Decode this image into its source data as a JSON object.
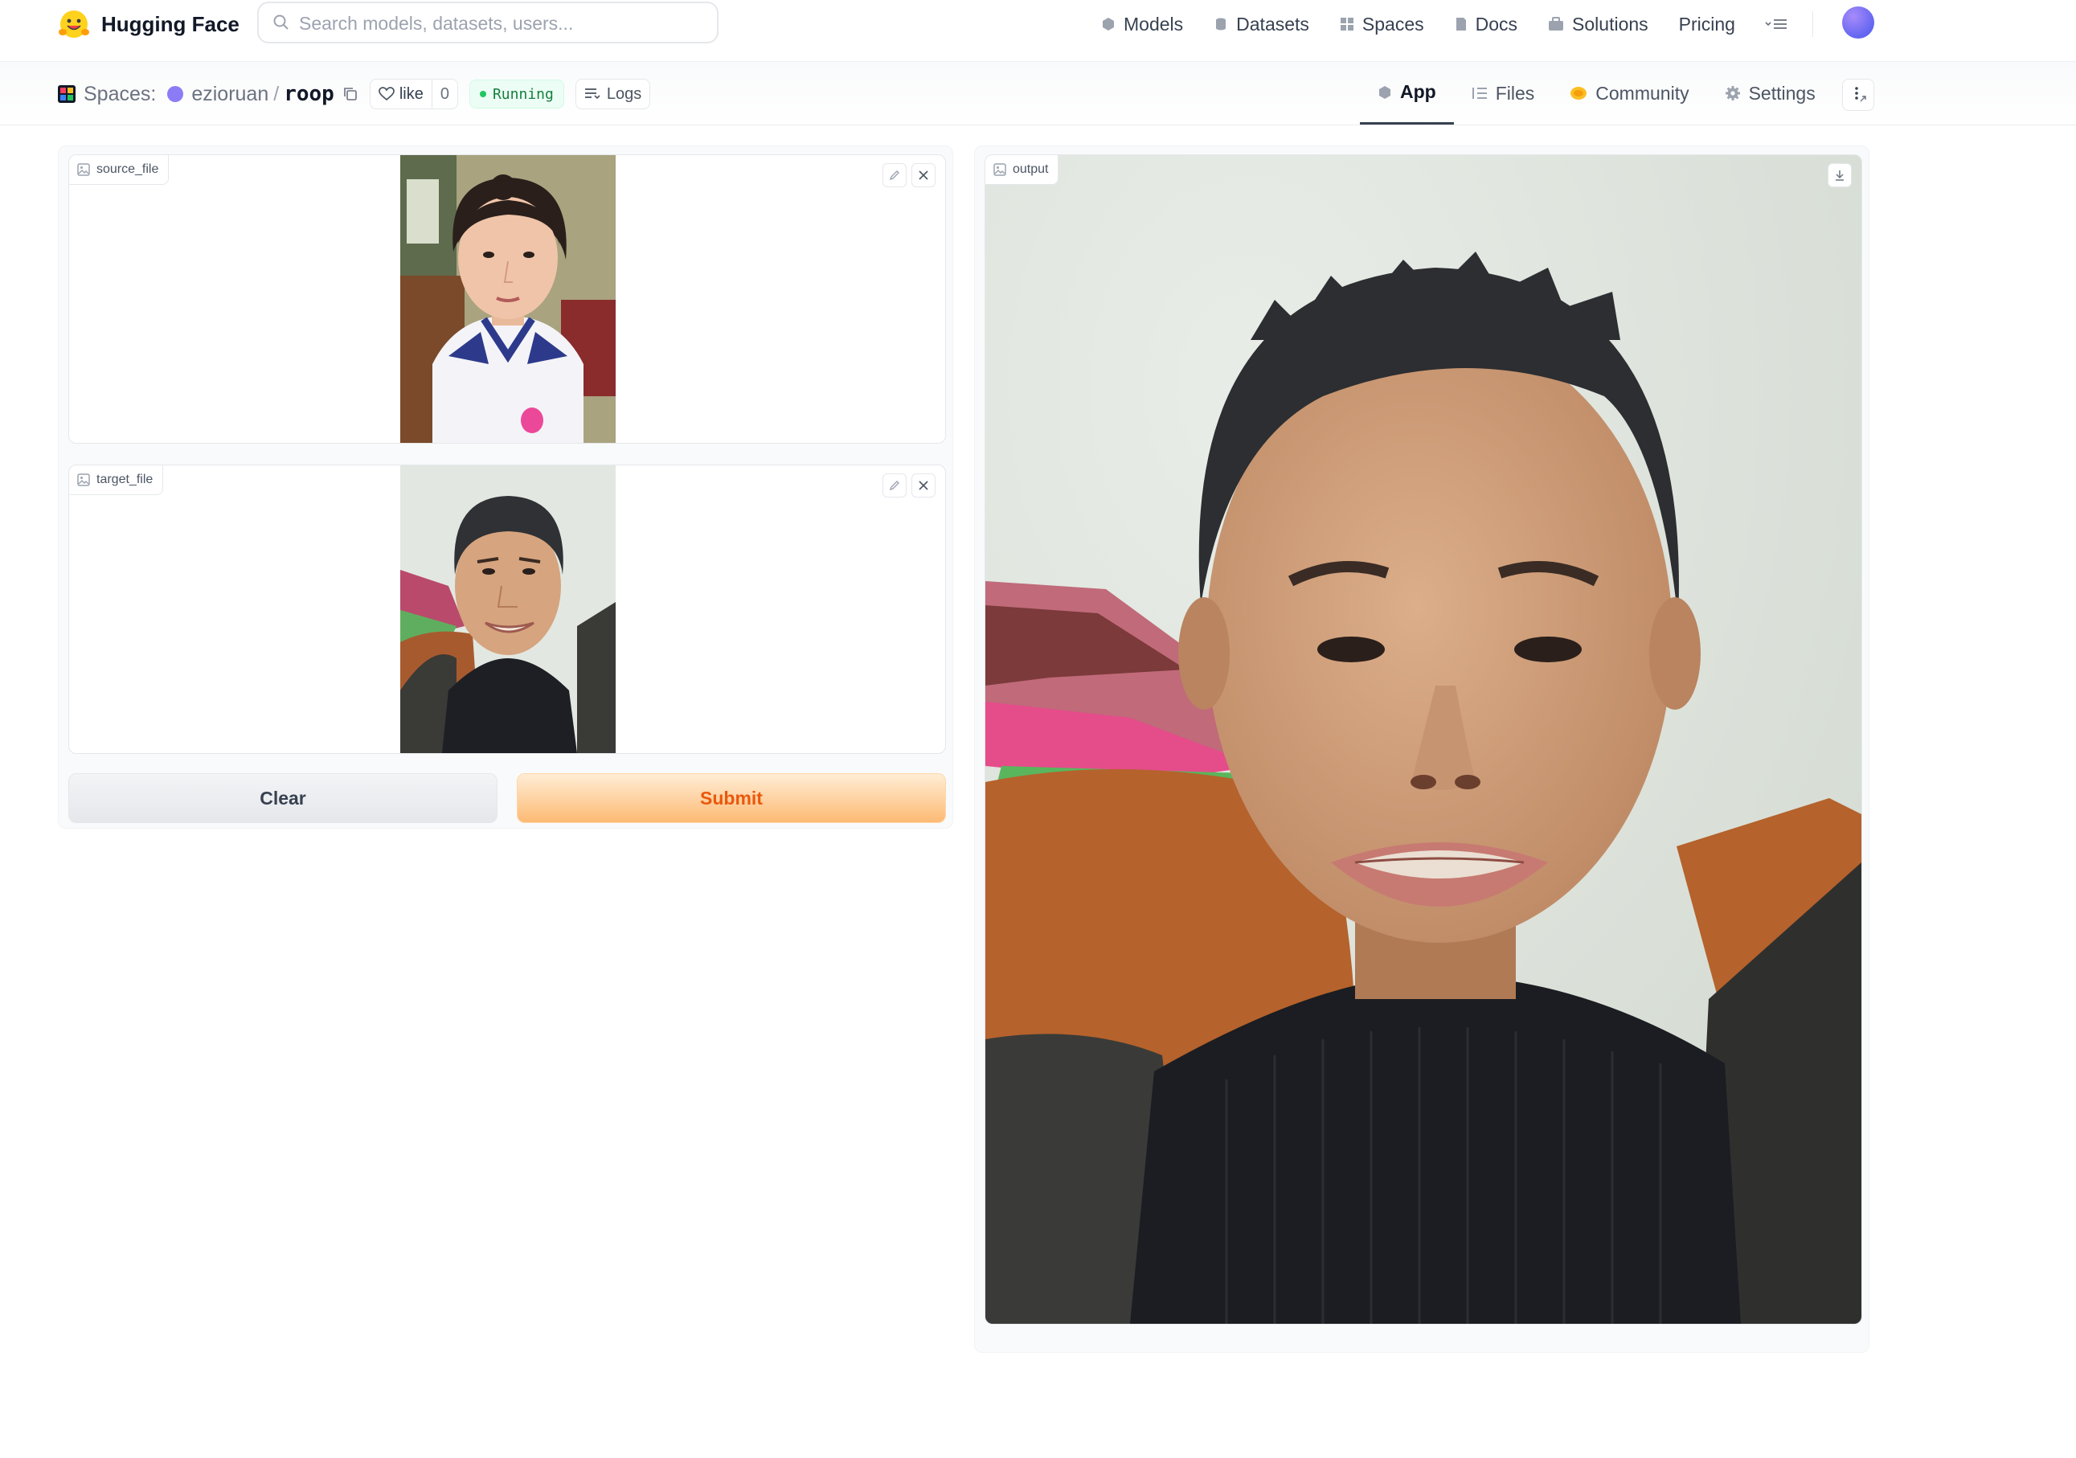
{
  "nav": {
    "brand": "Hugging Face",
    "search_placeholder": "Search models, datasets, users...",
    "links": {
      "models": "Models",
      "datasets": "Datasets",
      "spaces": "Spaces",
      "docs": "Docs",
      "solutions": "Solutions",
      "pricing": "Pricing"
    }
  },
  "space": {
    "spaces_label": "Spaces:",
    "owner": "ezioruan",
    "separator": "/",
    "repo": "roop",
    "like_label": "like",
    "like_count": "0",
    "status": "Running",
    "logs_label": "Logs",
    "tabs": {
      "app": "App",
      "files": "Files",
      "community": "Community",
      "settings": "Settings"
    }
  },
  "app": {
    "source_label": "source_file",
    "target_label": "target_file",
    "output_label": "output",
    "clear_label": "Clear",
    "submit_label": "Submit"
  },
  "colors": {
    "accent_orange": "#ea580c",
    "submit_bg": "#fdba74",
    "running_green": "#22c55e"
  }
}
